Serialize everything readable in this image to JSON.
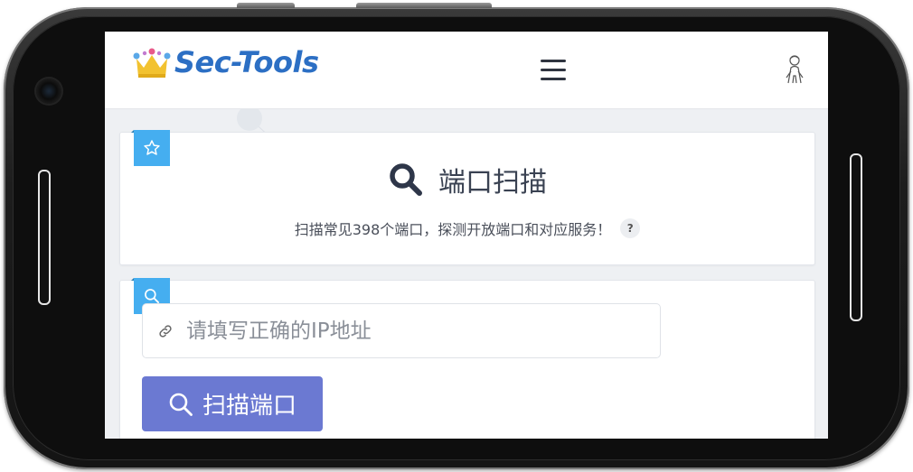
{
  "header": {
    "brand": "Sec-Tools"
  },
  "tool_card": {
    "title": "端口扫描",
    "description": "扫描常见398个端口，探测开放端口和对应服务！",
    "help_label": "?"
  },
  "scan_form": {
    "ip_placeholder": "请填写正确的IP地址",
    "ip_value": "",
    "scan_button_label": "扫描端口"
  },
  "colors": {
    "brand": "#2c6fc4",
    "badge": "#45aef0",
    "button": "#6b79d2"
  },
  "icons": {
    "logo": "crown-icon",
    "menu": "hamburger-menu-icon",
    "avatar": "user-avatar-icon",
    "card1_badge": "star-icon",
    "card2_badge": "search-icon",
    "title": "search-icon",
    "input": "link-icon",
    "button": "search-icon"
  }
}
